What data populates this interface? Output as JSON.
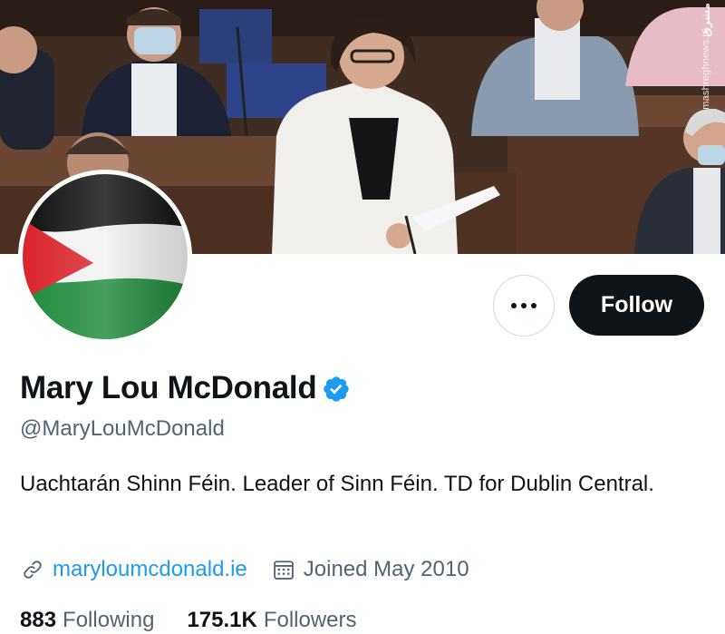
{
  "banner": {
    "watermark_logo": "مشرق",
    "watermark_url": "mashreghnews.ir"
  },
  "profile": {
    "display_name": "Mary Lou McDonald",
    "handle": "@MaryLouMcDonald",
    "bio": "Uachtarán Shinn Féin. Leader of Sinn Féin. TD for Dublin Central.",
    "website": "maryloumcdonald.ie",
    "joined": "Joined May 2010",
    "verified": true
  },
  "actions": {
    "follow_label": "Follow"
  },
  "stats": {
    "following_count": "883",
    "following_label": "Following",
    "followers_count": "175.1K",
    "followers_label": "Followers"
  },
  "icons": {
    "verified": "verified-badge-icon",
    "link": "link-icon",
    "calendar": "calendar-icon",
    "more": "more-options-icon"
  },
  "colors": {
    "accent_blue": "#1d9bf0",
    "follow_button_bg": "#0f1419",
    "secondary_text": "#536471",
    "flag_black": "#111111",
    "flag_white": "#f2f2f2",
    "flag_green": "#1f8a3a",
    "flag_red": "#d9252c"
  }
}
